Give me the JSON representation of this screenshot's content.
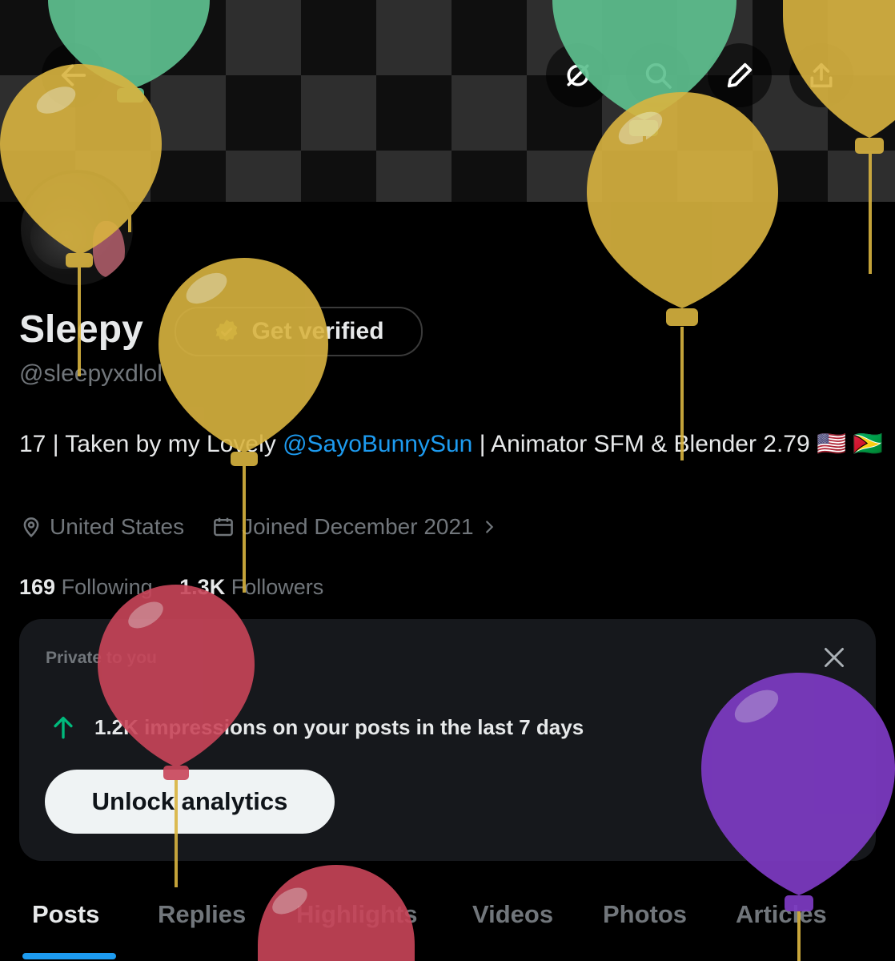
{
  "header": {
    "back_icon": "arrow-left-icon",
    "action_icons": [
      "grok-icon",
      "search-icon",
      "edit-icon",
      "share-icon"
    ]
  },
  "profile": {
    "name": "Sleepy",
    "verify_label": "Get verified",
    "handle": "@sleepyxdlol",
    "bio_prefix": "17 | Taken by my Lovely ",
    "bio_mention": "@SayoBunnySun",
    "bio_suffix": " | Animator SFM & Blender 2.79 🇺🇸 🇬🇾",
    "location": "United States",
    "joined": "Joined December 2021",
    "following_count": "169",
    "following_label": "Following",
    "followers_count": "1.3K",
    "followers_label": "Followers"
  },
  "insight_card": {
    "title": "Private to you",
    "impressions_text": "1.2K impressions on your posts in the last 7 days",
    "button_label": "Unlock analytics"
  },
  "tabs": [
    {
      "label": "Posts",
      "active": true
    },
    {
      "label": "Replies"
    },
    {
      "label": "Highlights"
    },
    {
      "label": "Videos"
    },
    {
      "label": "Photos"
    },
    {
      "label": "Articles"
    }
  ],
  "colors": {
    "accent": "#1d9bf0",
    "balloon_green": "#5ec08f",
    "balloon_yellow": "#d9b440",
    "balloon_red": "#c94559",
    "balloon_purple": "#7e3bc4"
  }
}
